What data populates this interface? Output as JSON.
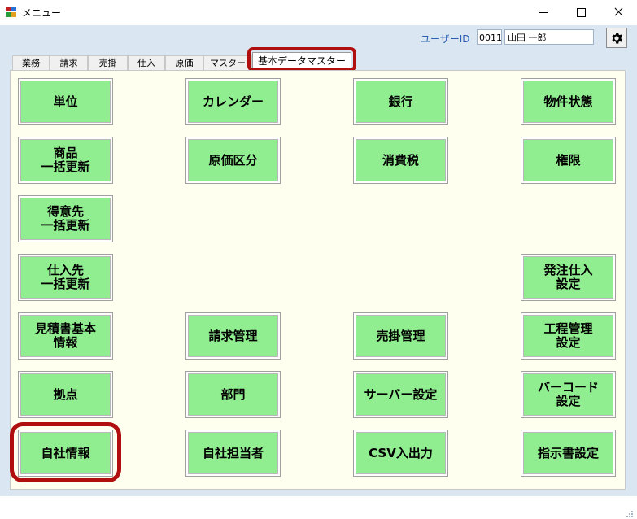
{
  "window": {
    "title": "メニュー"
  },
  "header": {
    "userid_label": "ユーザーID",
    "userid_value": "0011",
    "username_value": "山田 一郎",
    "settings_icon": "gear-icon"
  },
  "tabs": [
    {
      "label": "業務"
    },
    {
      "label": "請求"
    },
    {
      "label": "売掛"
    },
    {
      "label": "仕入"
    },
    {
      "label": "原価"
    },
    {
      "label": "マスター"
    },
    {
      "label": "基本データマスター"
    }
  ],
  "buttons": {
    "tani": "単位",
    "calendar": "カレンダー",
    "ginko": "銀行",
    "bukken_jotai": "物件状態",
    "shohin_ikkatsu": "商品\n一括更新",
    "genka_kubun": "原価区分",
    "shohizei": "消費税",
    "kengen": "権限",
    "tokuisaki_ikkatsu": "得意先\n一括更新",
    "shiiresaki_ikkatsu": "仕入先\n一括更新",
    "hatchu_shiire": "発注仕入\n設定",
    "mitsumori_kihon": "見積書基本\n情報",
    "seikyu_kanri": "請求管理",
    "urikake_kanri": "売掛管理",
    "kotei_kanri": "工程管理\n設定",
    "kyoten": "拠点",
    "bumon": "部門",
    "server_settei": "サーバー設定",
    "barcode_settei": "バーコード\n設定",
    "jisha_joho": "自社情報",
    "jisha_tanto": "自社担当者",
    "csv_io": "CSV入出力",
    "shijisho_settei": "指示書設定"
  },
  "colors": {
    "button_bg": "#90ee90",
    "panel_bg": "#fffff0",
    "client_bg": "#dbe6f3",
    "highlight": "#b10f0f",
    "userid_label": "#2a5db0"
  }
}
